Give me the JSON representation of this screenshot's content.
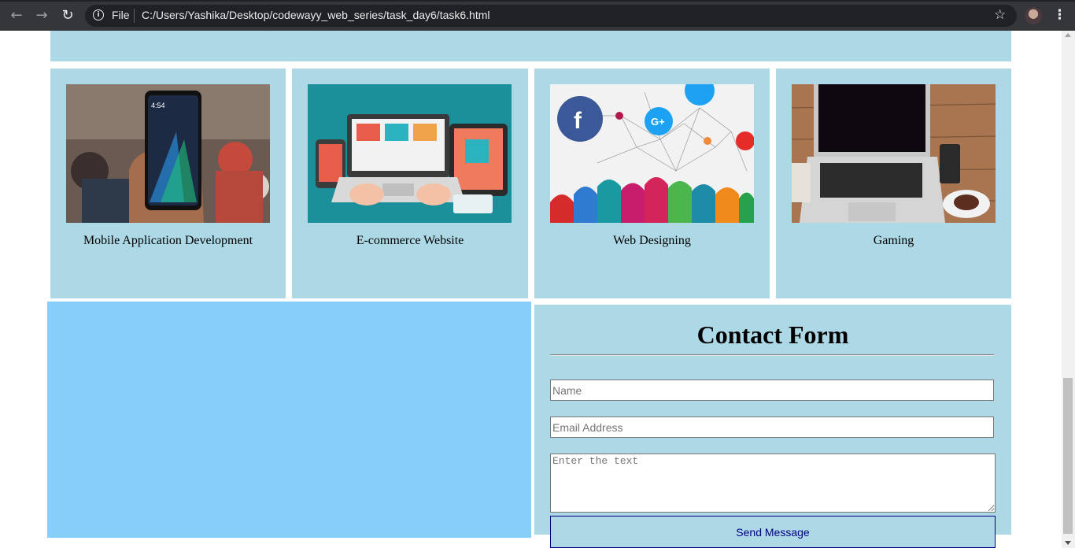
{
  "browser": {
    "file_label": "File",
    "url": "C:/Users/Yashika/Desktop/codewayy_web_series/task_day6/task6.html",
    "icons": [
      "back-icon",
      "forward-icon",
      "reload-icon",
      "info-icon",
      "star-icon",
      "profile-avatar",
      "menu-icon"
    ]
  },
  "services": [
    {
      "title": "Mobile Application Development",
      "image": "smartphone-photo"
    },
    {
      "title": "E-commerce Website",
      "image": "laptop-ecommerce-illustration"
    },
    {
      "title": "Web Designing",
      "image": "social-network-illustration"
    },
    {
      "title": "Gaming",
      "image": "laptop-desk-photo"
    }
  ],
  "contact": {
    "title": "Contact Form",
    "name_placeholder": "Name",
    "email_placeholder": "Email Address",
    "message_placeholder": "Enter the text",
    "send_label": "Send Message"
  },
  "colors": {
    "panel": "#add8e6",
    "side_box": "#87cefa",
    "button_text": "#000080"
  }
}
